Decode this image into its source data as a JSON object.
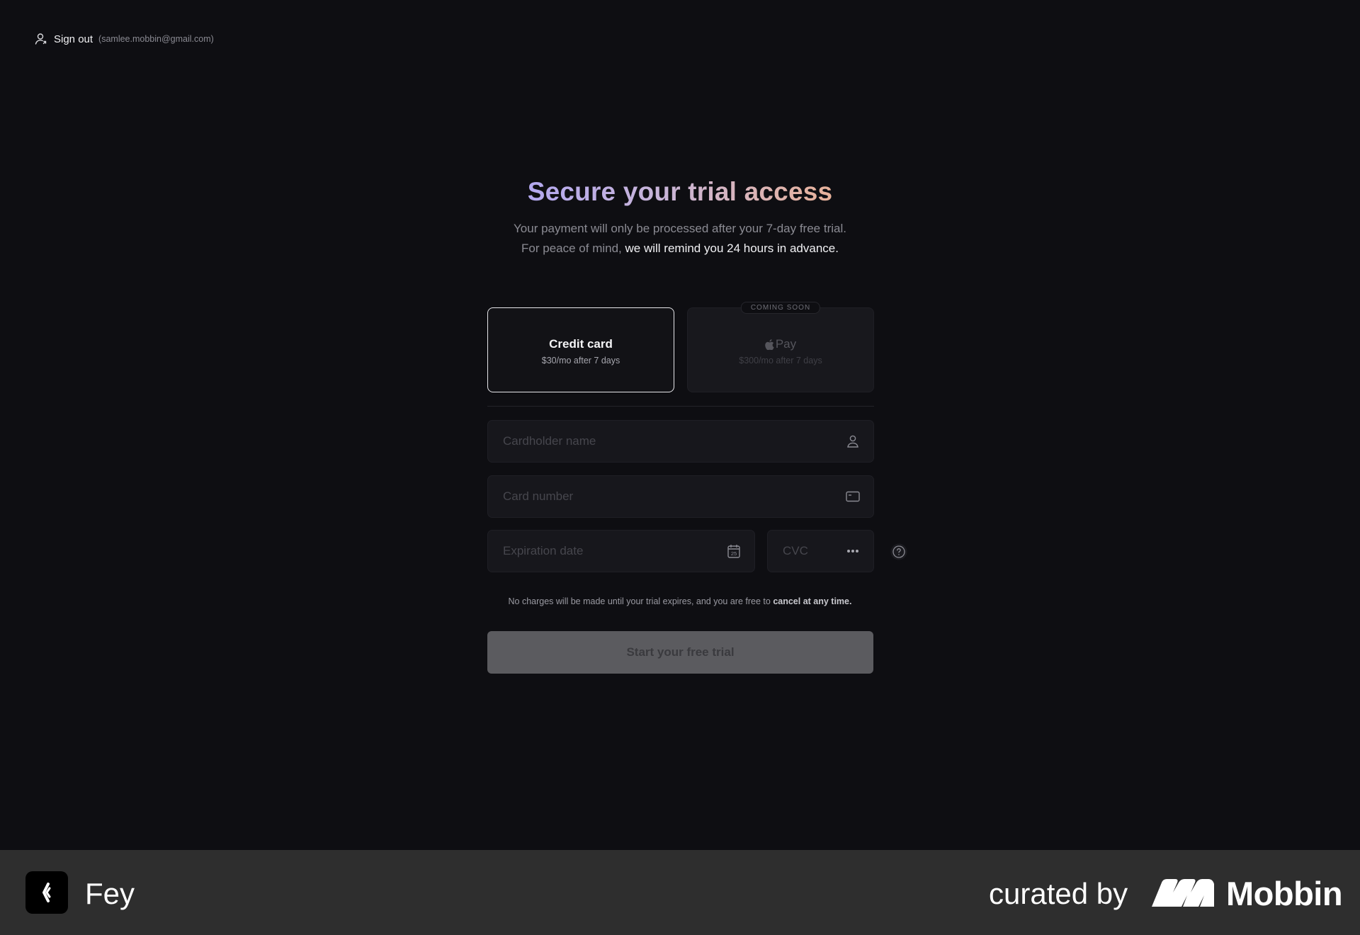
{
  "header": {
    "signout_label": "Sign out",
    "email": "(samlee.mobbin@gmail.com)",
    "icon": "user-icon"
  },
  "hero": {
    "title": "Secure your trial access",
    "subtitle_line1": "Your payment will only be processed after your 7-day free trial.",
    "subtitle_line2_prefix": "For peace of mind,",
    "subtitle_line2_highlight": "we will remind you 24 hours in advance."
  },
  "payment_methods": {
    "credit_card": {
      "label": "Credit card",
      "price": "$30/mo after 7 days",
      "selected": true
    },
    "apple_pay": {
      "label": "Pay",
      "icon": "apple-icon",
      "price": "$300/mo after 7 days",
      "badge": "COMING SOON",
      "disabled": true
    }
  },
  "form": {
    "cardholder_placeholder": "Cardholder name",
    "cardholder_value": "",
    "cardholder_icon": "user-icon",
    "card_number_placeholder": "Card number",
    "card_number_value": "",
    "card_number_icon": "credit-card-icon",
    "expiration_placeholder": "Expiration date",
    "expiration_value": "",
    "expiration_icon": "calendar-icon",
    "expiration_icon_text": "25",
    "cvc_placeholder": "CVC",
    "cvc_value": "",
    "cvc_icon": "dots-icon",
    "help_icon": "question-icon"
  },
  "notice": {
    "text": "No charges will be made until your trial expires, and you are free to",
    "emphasis": "cancel at any time."
  },
  "cta": {
    "label": "Start your free trial",
    "disabled": true
  },
  "footer": {
    "app_name": "Fey",
    "curated_label": "curated by",
    "brand_name": "Mobbin"
  },
  "colors": {
    "background": "#0e0e12",
    "title_gradient_start": "#b3a8f0",
    "title_gradient_end": "#e8b29a",
    "cta_bg": "#5b5b5f",
    "footer_bg": "#2e2e2e"
  }
}
